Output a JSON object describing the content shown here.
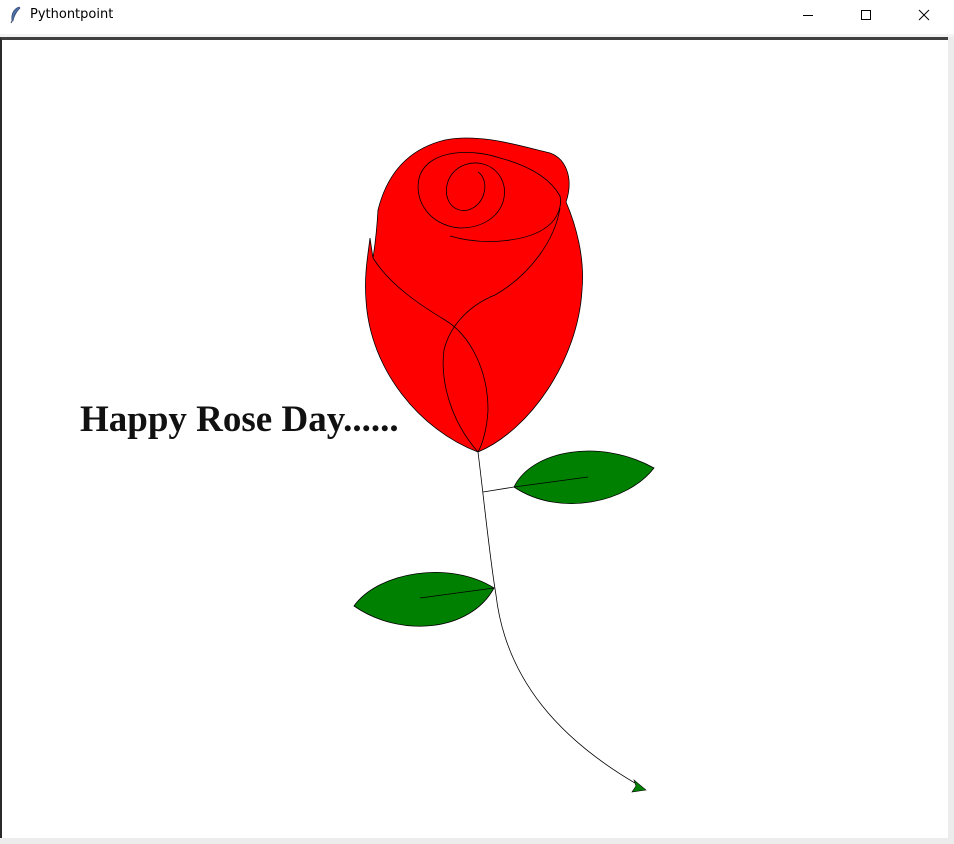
{
  "window": {
    "title": "Pythontpoint",
    "app_icon": "feather-icon",
    "controls": {
      "minimize_icon": "minimize-icon",
      "maximize_icon": "maximize-icon",
      "close_icon": "close-icon"
    }
  },
  "canvas": {
    "greeting": "Happy Rose Day......",
    "colors": {
      "petal": "#ff0000",
      "leaf": "#008000",
      "outline": "#000000",
      "background": "#ffffff"
    },
    "drawing": "rose-drawing"
  }
}
